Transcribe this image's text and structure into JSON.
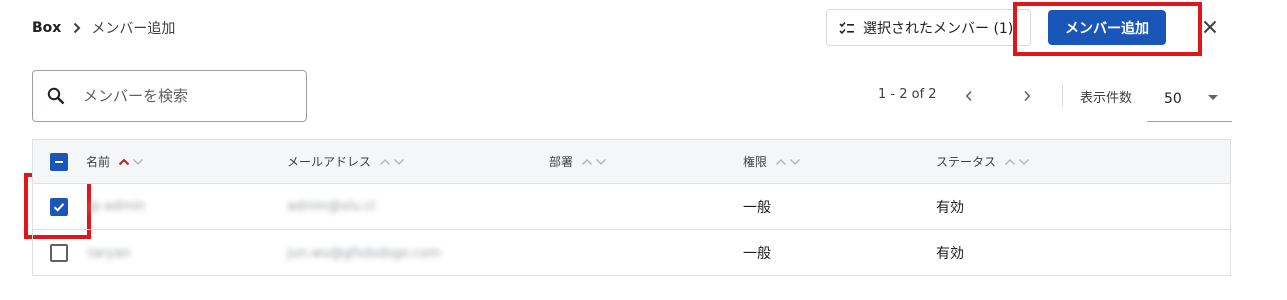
{
  "breadcrumb": {
    "root": "Box",
    "current": "メンバー追加"
  },
  "toolbar": {
    "selected_members_label": "選択されたメンバー (1)",
    "add_member_label": "メンバー追加"
  },
  "search": {
    "placeholder": "メンバーを検索"
  },
  "pagination": {
    "range": "1 - 2 of 2",
    "per_page_label": "表示件数",
    "per_page_value": "50"
  },
  "table": {
    "columns": [
      "名前",
      "メールアドレス",
      "部署",
      "権限",
      "ステータス"
    ],
    "rows": [
      {
        "name": "jp-admin",
        "email": "admin@xlu.cl",
        "department": "",
        "role": "一般",
        "status": "有効",
        "checked": true
      },
      {
        "name": "taryan",
        "email": "jun.wu@gfsdsdsgo.com",
        "department": "",
        "role": "一般",
        "status": "有効",
        "checked": false
      }
    ]
  },
  "colors": {
    "accent": "#1a56b8",
    "highlight": "#e0161c",
    "sort_active": "#b3261e"
  },
  "icons": [
    "chevron-right-icon",
    "checklist-icon",
    "close-icon",
    "search-icon",
    "chevron-left-icon",
    "caret-down-icon",
    "sort-up-icon",
    "sort-down-icon",
    "checkbox-icon"
  ]
}
